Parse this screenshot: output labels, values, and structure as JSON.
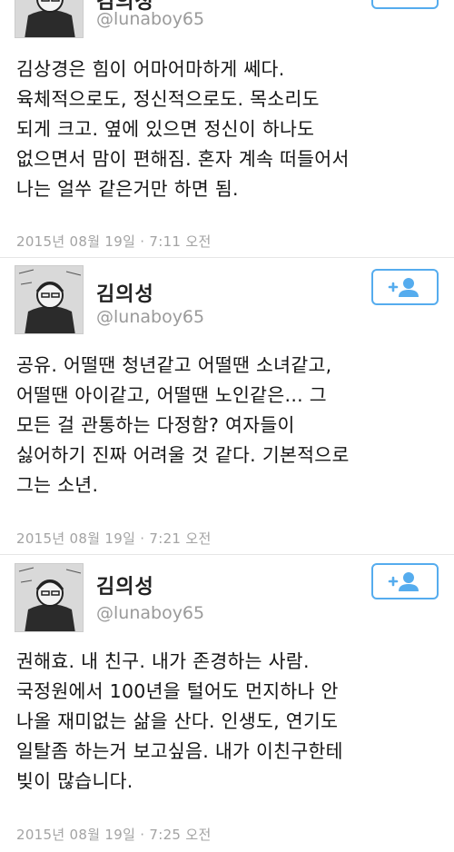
{
  "tweets": [
    {
      "name": "김의성",
      "handle": "@lunaboy65",
      "body": "김상경은 힘이 어마어마하게 쎄다.\n육체적으로도, 정신적으로도. 목소리도\n되게 크고. 옆에 있으면 정신이 하나도\n없으면서 맘이 편해짐. 혼자 계속 떠들어서\n나는 얼쑤 같은거만 하면 됨.",
      "time": "2015년 08월 19일 · 7:11 오전",
      "follow_icon": "add-user-icon"
    },
    {
      "name": "김의성",
      "handle": "@lunaboy65",
      "body": "공유. 어떨땐 청년같고 어떨땐 소녀같고,\n어떨땐 아이같고, 어떨땐 노인같은... 그\n모든 걸 관통하는 다정함? 여자들이\n싫어하기 진짜 어려울 것 같다. 기본적으로\n그는 소년.",
      "time": "2015년 08월 19일 · 7:21 오전",
      "follow_icon": "add-user-icon"
    },
    {
      "name": "김의성",
      "handle": "@lunaboy65",
      "body": "권해효. 내 친구. 내가 존경하는 사람.\n국정원에서 100년을 털어도 먼지하나 안\n나올 재미없는 삶을 산다. 인생도, 연기도\n일탈좀 하는거 보고싶음. 내가 이친구한테\n빚이 많습니다.",
      "time": "2015년 08월 19일 · 7:25 오전",
      "follow_icon": "add-user-icon"
    }
  ],
  "colors": {
    "accent": "#55acee",
    "muted": "#9a9a9a"
  }
}
